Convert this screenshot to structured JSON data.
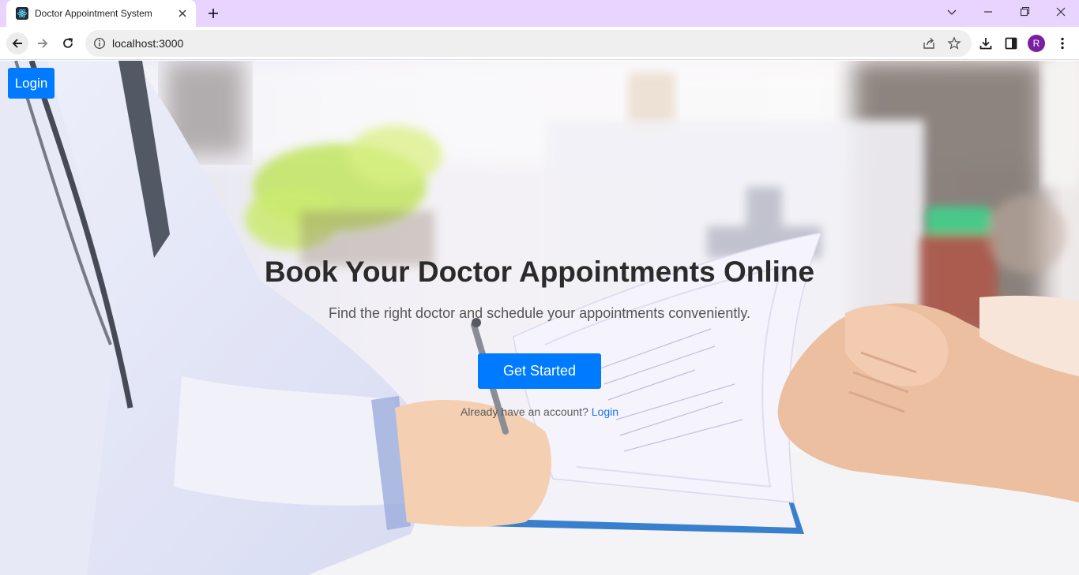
{
  "browser": {
    "tab": {
      "title": "Doctor Appointment System",
      "favicon": "react-icon"
    },
    "url": "localhost:3000",
    "profile_initial": "R",
    "accent": "#e9d3ff"
  },
  "page": {
    "nav_login_label": "Login",
    "hero": {
      "title": "Book Your Doctor Appointments Online",
      "subtitle": "Find the right doctor and schedule your appointments conveniently.",
      "cta_label": "Get Started",
      "account_prompt": "Already have an account?",
      "account_link": "Login"
    },
    "colors": {
      "primary": "#007bff",
      "link": "#1a73e8",
      "title": "#2b2b2b"
    }
  }
}
